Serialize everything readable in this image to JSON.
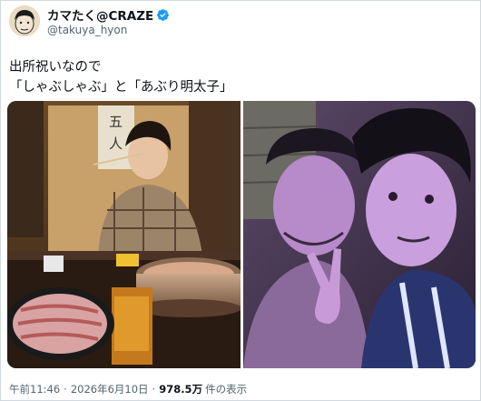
{
  "author": {
    "display_name": "カマたく@CRAZE",
    "handle": "@takuya_hyon",
    "verified_icon": "verified-badge-icon",
    "badge_color": "#1d9bf0"
  },
  "tweet": {
    "lines": [
      "出所祝いなので",
      "「しゃぶしゃぶ」と「あぶり明太子」"
    ]
  },
  "meta": {
    "time": "午前11:46",
    "date": "2026年6月10日",
    "views_count": "978.5万",
    "views_label": "件の表示",
    "separator": "·"
  }
}
